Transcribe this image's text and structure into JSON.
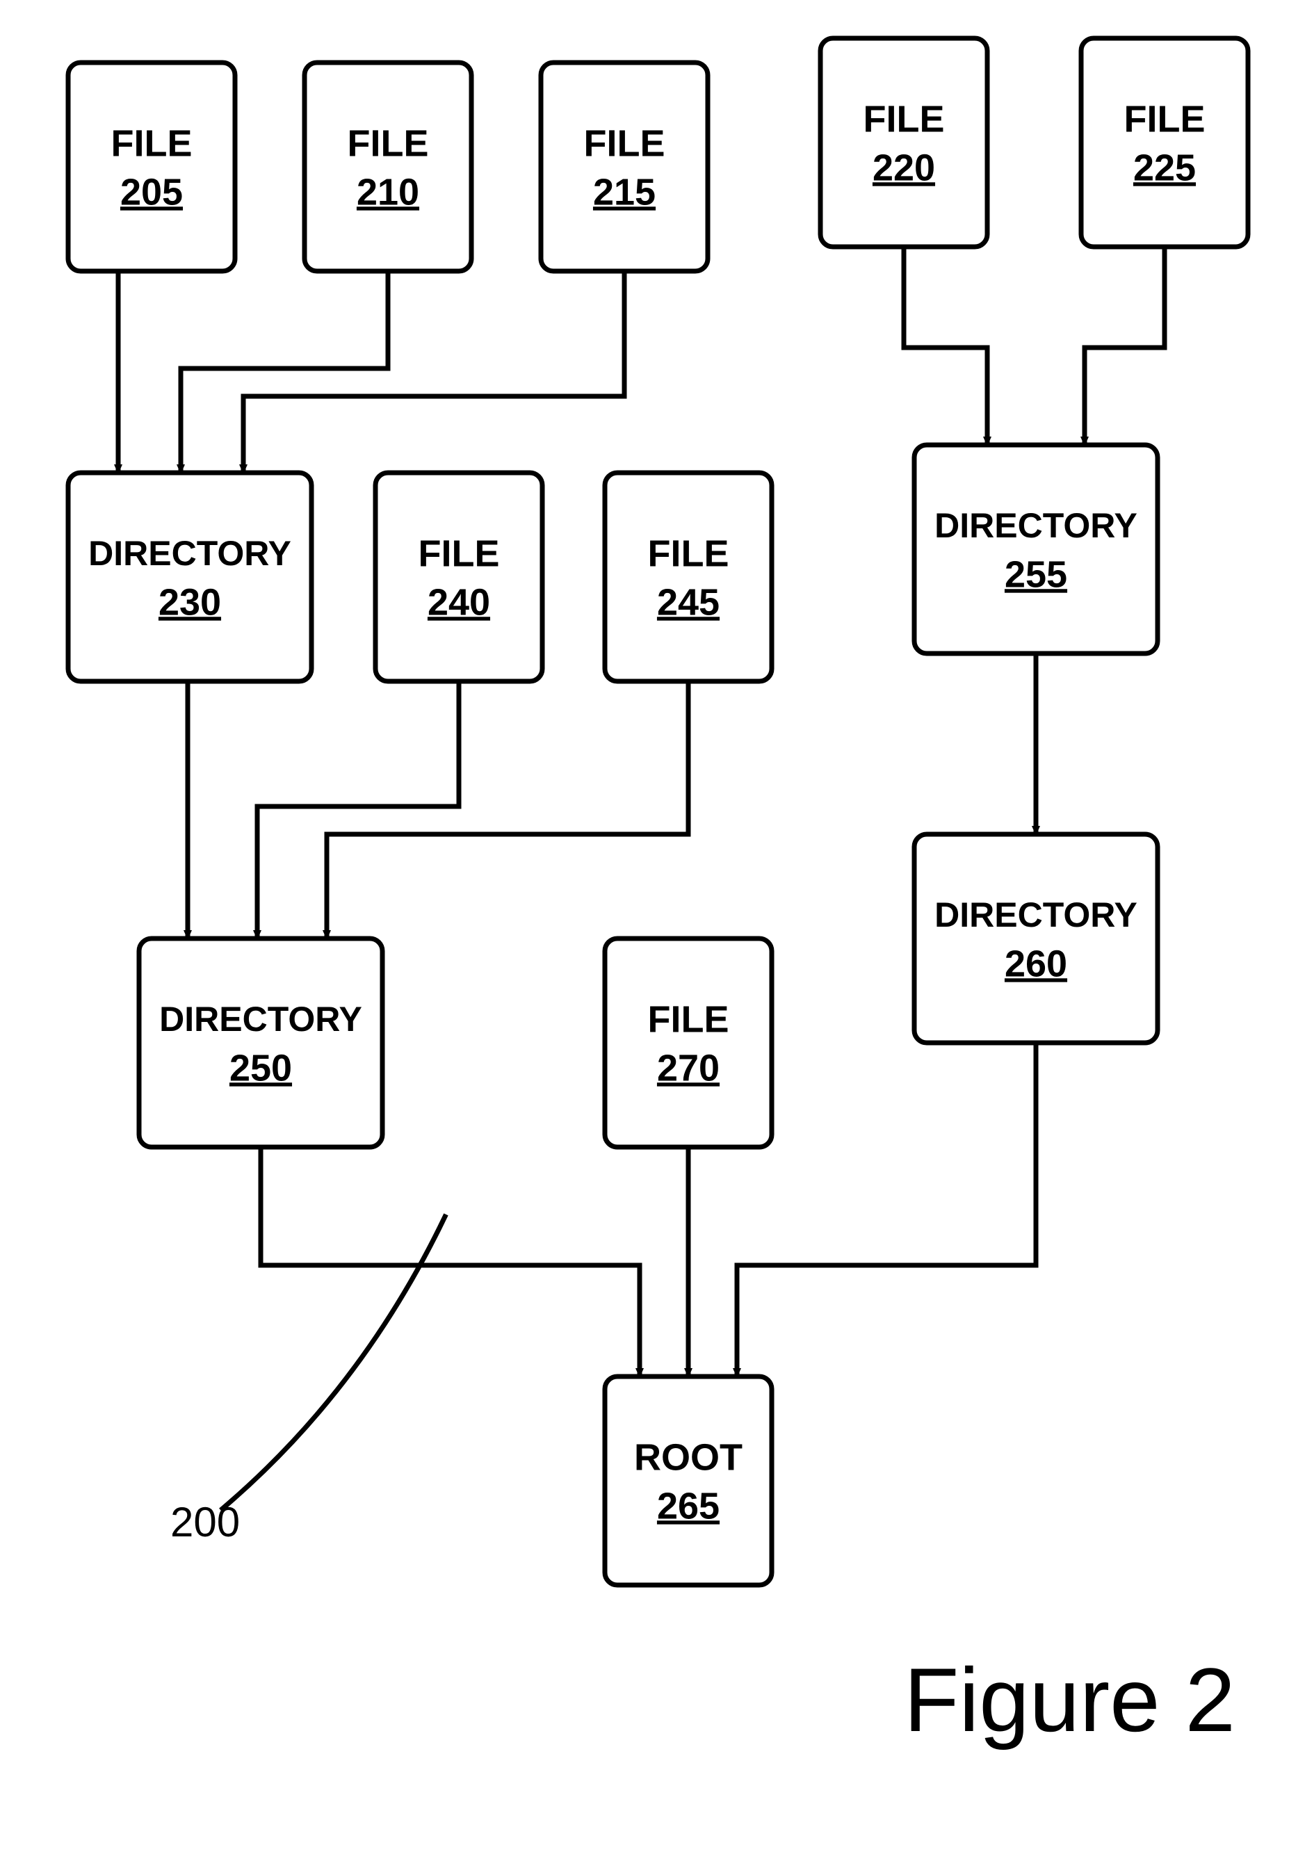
{
  "nodes": {
    "n205": {
      "title": "FILE",
      "num": "205"
    },
    "n210": {
      "title": "FILE",
      "num": "210"
    },
    "n215": {
      "title": "FILE",
      "num": "215"
    },
    "n220": {
      "title": "FILE",
      "num": "220"
    },
    "n225": {
      "title": "FILE",
      "num": "225"
    },
    "n230": {
      "title": "DIRECTORY",
      "num": "230"
    },
    "n240": {
      "title": "FILE",
      "num": "240"
    },
    "n245": {
      "title": "FILE",
      "num": "245"
    },
    "n255": {
      "title": "DIRECTORY",
      "num": "255"
    },
    "n250": {
      "title": "DIRECTORY",
      "num": "250"
    },
    "n270": {
      "title": "FILE",
      "num": "270"
    },
    "n260": {
      "title": "DIRECTORY",
      "num": "260"
    },
    "n265": {
      "title": "ROOT",
      "num": "265"
    },
    "ref": {
      "label": "200"
    },
    "figure": {
      "label": "Figure 2"
    }
  }
}
